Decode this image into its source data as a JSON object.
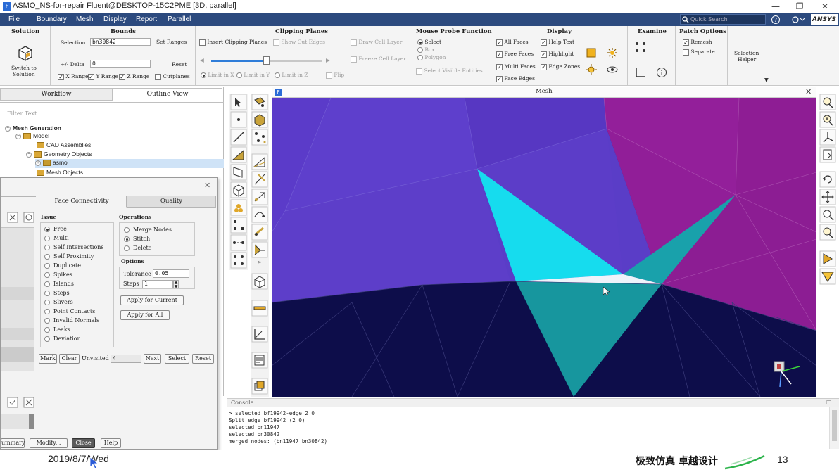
{
  "window": {
    "title": "ASMO_NS-for-repair Fluent@DESKTOP-15C2PME  [3D, parallel]",
    "minimize_icon": "minimize-icon",
    "restore_icon": "restore-icon",
    "close_icon": "close-icon"
  },
  "menu": {
    "items": [
      "File",
      "Boundary",
      "Mesh",
      "Display",
      "Report",
      "Parallel"
    ],
    "quick_search_placeholder": "Quick Search",
    "help_icon": "help-icon",
    "brand": "ANSYS"
  },
  "ribbon": {
    "solution": {
      "title": "Solution",
      "switch_label_1": "Switch to",
      "switch_label_2": "Solution"
    },
    "bounds": {
      "title": "Bounds",
      "selection_label": "Selection",
      "selection_value": "bn30842",
      "set_ranges": "Set Ranges",
      "delta_label": "+/- Delta",
      "delta_value": "0",
      "reset": "Reset",
      "x_range": "X Range",
      "y_range": "Y Range",
      "z_range": "Z Range",
      "cutplanes": "Cutplanes"
    },
    "clipping": {
      "title": "Clipping Planes",
      "insert": "Insert Clipping Planes",
      "show_cut_edges": "Show Cut Edges",
      "draw_cell_layer": "Draw Cell Layer",
      "freeze_cell_layer": "Freeze Cell Layer",
      "limit_x": "Limit in X",
      "limit_y": "Limit in Y",
      "limit_z": "Limit in Z",
      "flip": "Flip"
    },
    "mouse_probe": {
      "title": "Mouse Probe Function",
      "select": "Select",
      "box": "Box",
      "polygon": "Polygon",
      "select_visible": "Select Visible Entities"
    },
    "display": {
      "title": "Display",
      "all_faces": "All Faces",
      "free_faces": "Free Faces",
      "multi_faces": "Multi Faces",
      "face_edges": "Face Edges",
      "help_text": "Help Text",
      "highlight": "Highlight",
      "edge_zones": "Edge Zones"
    },
    "examine": {
      "title": "Examine"
    },
    "patch": {
      "title": "Patch Options",
      "remesh": "Remesh",
      "separate": "Separate"
    },
    "selection_helper": {
      "line1": "Selection",
      "line2": "Helper"
    }
  },
  "left_panel": {
    "tabs": [
      "Workflow",
      "Outline View"
    ],
    "filter_placeholder": "Filter Text",
    "tree": {
      "root": "Mesh Generation",
      "model": "Model",
      "cad": "CAD Assemblies",
      "geometry": "Geometry Objects",
      "asmo": "asmo",
      "mesh_objects": "Mesh Objects"
    }
  },
  "dialog": {
    "tabs": [
      "Face Connectivity",
      "Quality"
    ],
    "issue_title": "Issue",
    "issues": [
      "Free",
      "Multi",
      "Self Intersections",
      "Self Proximity",
      "Duplicate",
      "Spikes",
      "Islands",
      "Steps",
      "Slivers",
      "Point Contacts",
      "Invalid Normals",
      "Leaks",
      "Deviation"
    ],
    "issue_selected": "Free",
    "operations_title": "Operations",
    "operations": [
      "Merge Nodes",
      "Stitch",
      "Delete"
    ],
    "operation_selected": "Stitch",
    "options_title": "Options",
    "tolerance_label": "Tolerance",
    "tolerance_value": "0.05",
    "steps_label": "Steps",
    "steps_value": "1",
    "apply_current": "Apply for Current",
    "apply_all": "Apply for All",
    "mark": "Mark",
    "clear": "Clear",
    "unvisited_label": "Unvisited",
    "unvisited_value": "4",
    "next": "Next",
    "select": "Select",
    "reset": "Reset",
    "summary": "ummary",
    "modify": "Modify...",
    "close": "Close",
    "help": "Help"
  },
  "mesh_window": {
    "title": "Mesh"
  },
  "console": {
    "title": "Console",
    "lines": [
      "> selected bf19942-edge 2 0",
      "Split edge bf19942 (2 0)",
      "selected bn11947",
      "selected bn30842",
      "merged nodes: (bn11947 bn30842)"
    ]
  },
  "footer": {
    "date": "2019/8/7/Wed",
    "slogan": "极致仿真 卓越设计",
    "page": "13"
  },
  "colors": {
    "menubar": "#2c4a7e",
    "face_purple": "#5a3dc7",
    "face_magenta": "#8f1f96",
    "face_dark": "#0d0d4a",
    "highlight_cyan": "#16dcee",
    "teal": "#17969e"
  }
}
